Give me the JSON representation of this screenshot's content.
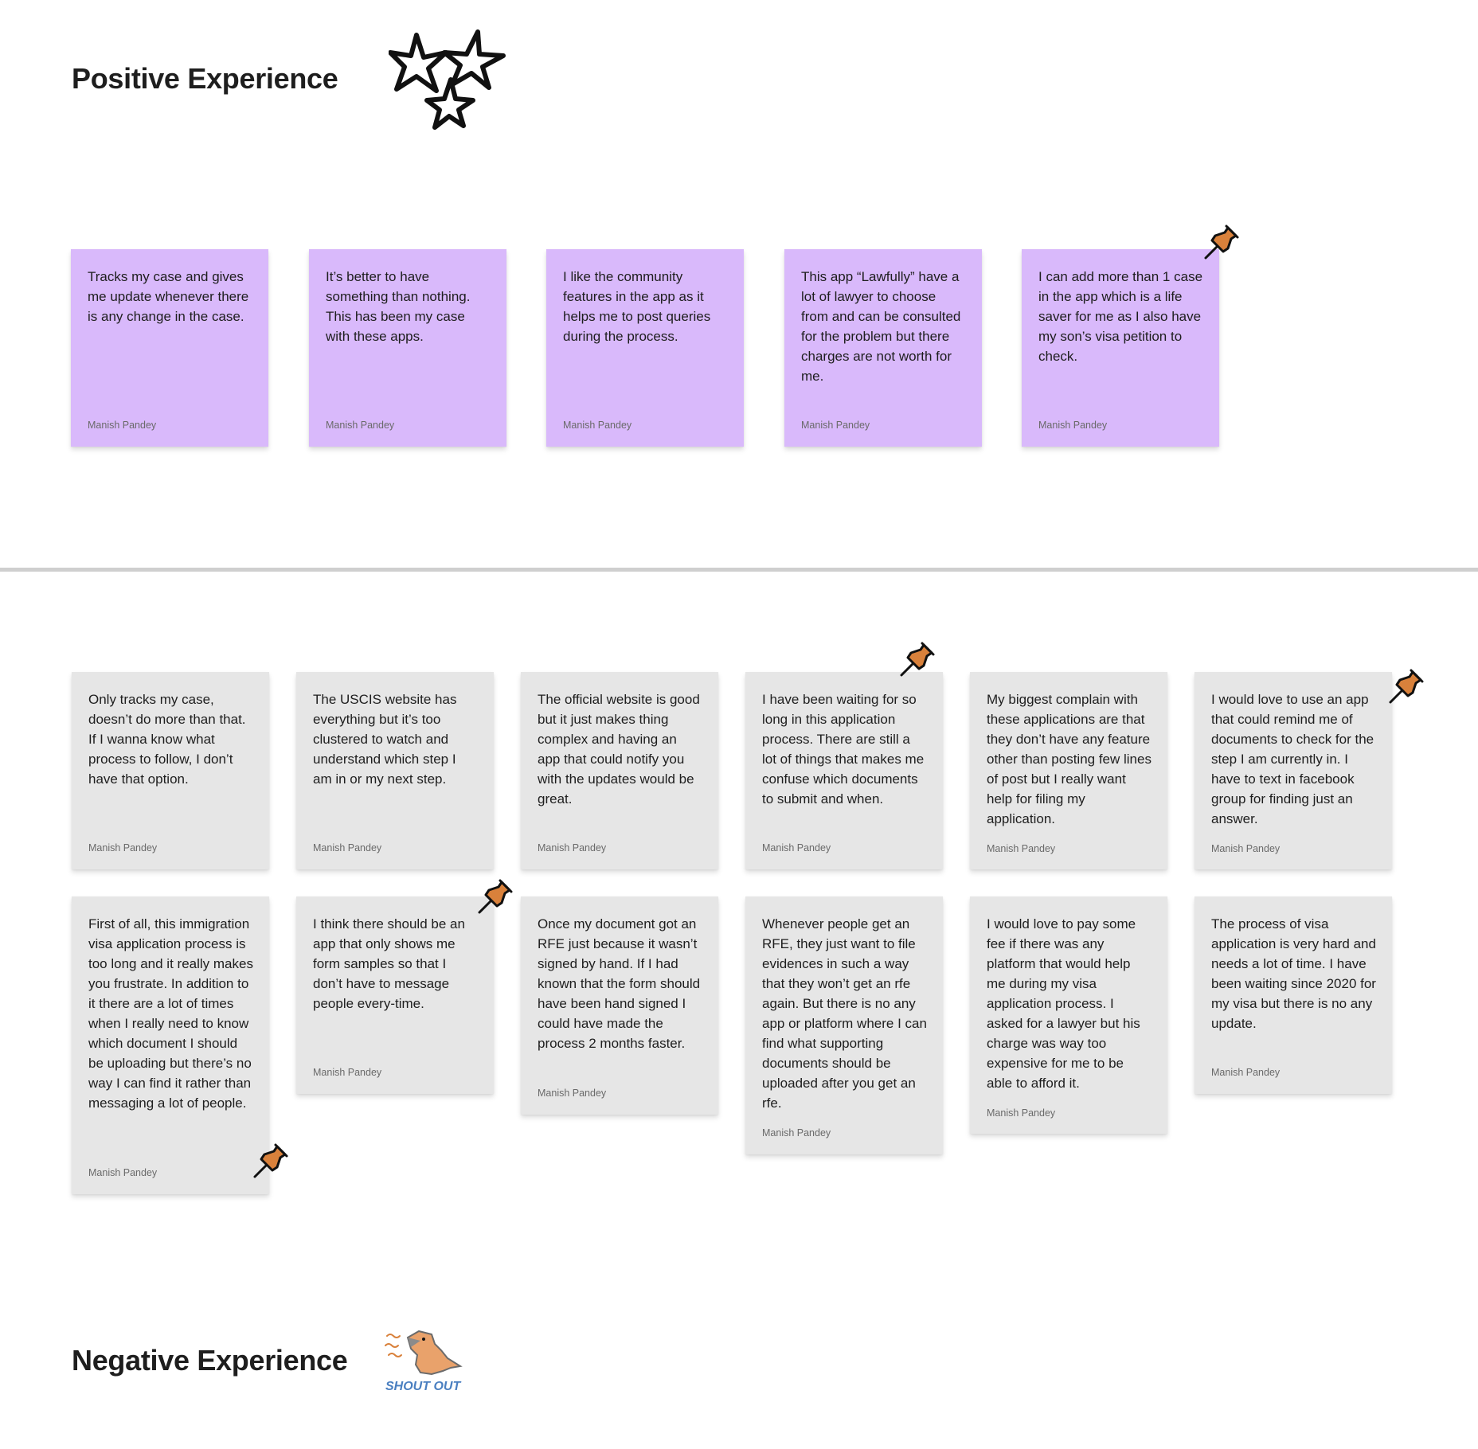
{
  "positive": {
    "title": "Positive Experience",
    "icon": "hand-drawn-stars-icon",
    "notes": [
      {
        "text": "Tracks my case and gives me update whenever there is any change in the case.",
        "author": "Manish Pandey"
      },
      {
        "text": "It’s better to have something than nothing. This has been my case with these apps.",
        "author": "Manish Pandey"
      },
      {
        "text": "I like the community features in the app as it helps me to post queries during the process.",
        "author": "Manish Pandey"
      },
      {
        "text": "This app “Lawfully” have a lot of lawyer to choose from and can be consulted for the problem but there charges are not worth for me.",
        "author": "Manish Pandey"
      },
      {
        "text": "I can add more than 1 case in the app which is a life saver for me as I also have my son’s visa petition to check.",
        "author": "Manish Pandey"
      }
    ]
  },
  "negative": {
    "title": "Negative Experience",
    "sticker_text": "SHOUT OUT",
    "notes": [
      {
        "text": "Only tracks my case, doesn’t do more than that. If I wanna know what process to follow, I don’t have that option.",
        "author": "Manish Pandey"
      },
      {
        "text": "The USCIS website has everything but it’s too clustered to watch and understand which step I am in or my next step.",
        "author": "Manish Pandey"
      },
      {
        "text": "The official website is good but it just makes thing complex and having an app that could notify you with the updates would be great.",
        "author": "Manish Pandey"
      },
      {
        "text": "I have been waiting for so long in this application process. There are still a lot of things that makes me confuse which documents to submit and when.",
        "author": "Manish Pandey"
      },
      {
        "text": "My biggest complain with these applications are that they don’t have any feature other than posting few lines of post but I really want help for filing my application.",
        "author": "Manish Pandey"
      },
      {
        "text": "I would love to use an app that could remind me of documents to check for the step I am currently in. I have to text in facebook group for finding just an answer.",
        "author": "Manish Pandey"
      },
      {
        "text": "First of all, this immigration visa application process is too long and it really makes you frustrate. In addition to it there are a lot of times when I really need to know which document I should be uploading but there’s no way I can find it rather than messaging a lot of people.",
        "author": "Manish Pandey"
      },
      {
        "text": "I think there should be an app that only shows me form samples so that I don’t have to message people every-time.",
        "author": "Manish Pandey"
      },
      {
        "text": "Once my document got an RFE just because it wasn’t signed by hand. If I had known that the form should have been hand signed I could have made the process 2 months faster.",
        "author": "Manish Pandey"
      },
      {
        "text": "Whenever people get an RFE, they just want to file evidences in such a way that they won’t get an rfe again. But there is no any app or platform where I can find what supporting documents should be uploaded after you get an rfe.",
        "author": "Manish Pandey"
      },
      {
        "text": "I would love to pay some fee if there was any platform that would help me during my visa application process. I asked for a lawyer but his charge was way too expensive for me to be able to afford it.",
        "author": "Manish Pandey"
      },
      {
        "text": "The process of visa application is very hard and needs a lot of time. I have been waiting since 2020 for my visa but there is no any update.",
        "author": "Manish Pandey"
      }
    ]
  },
  "colors": {
    "positive_note": "#d9b9fb",
    "negative_note": "#e6e6e6",
    "pin": "#d9813b",
    "divider": "#cfcfcf"
  },
  "icons": {
    "pin": "push-pin-icon",
    "stars": "hand-drawn-stars-icon",
    "sticker": "shout-out-dinosaur-sticker"
  }
}
